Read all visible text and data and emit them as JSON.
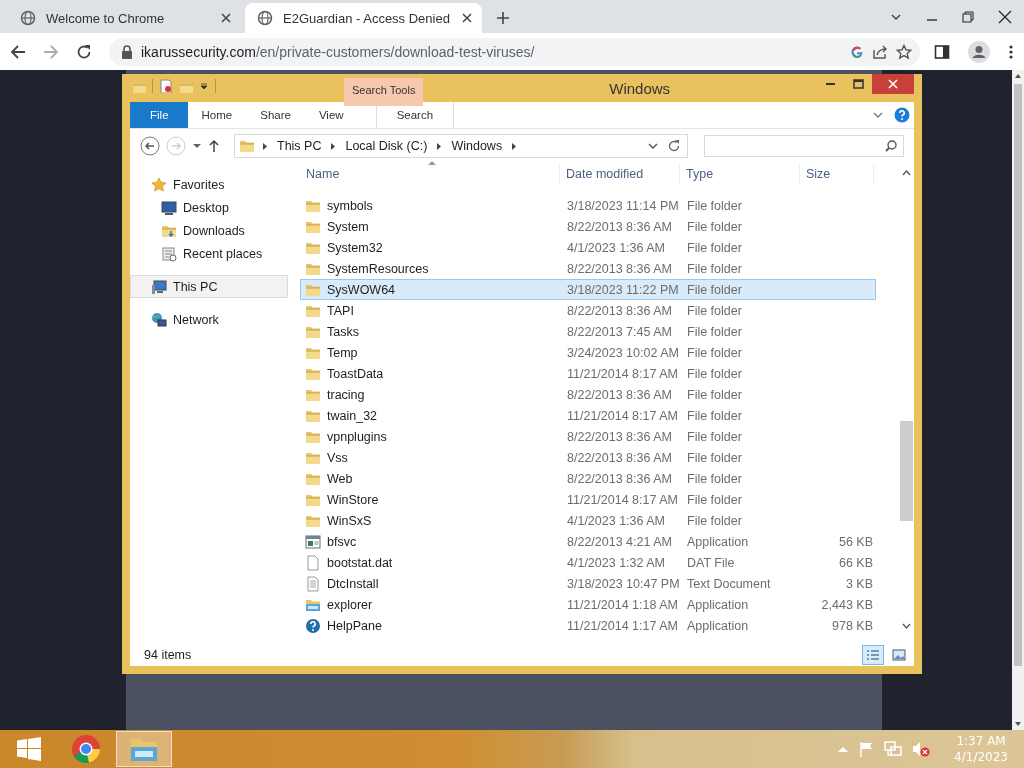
{
  "browser": {
    "tabs": [
      {
        "title": "Welcome to Chrome",
        "selected": false
      },
      {
        "title": "E2Guardian - Access Denied",
        "selected": true
      }
    ],
    "url_host": "ikarussecurity.com",
    "url_path": "/en/private-customers/download-test-viruses/"
  },
  "explorer": {
    "title": "Windows",
    "contextual_group": "Search Tools",
    "ribbon_tabs": [
      {
        "label": "File",
        "kind": "file"
      },
      {
        "label": "Home",
        "kind": "normal"
      },
      {
        "label": "Share",
        "kind": "normal"
      },
      {
        "label": "View",
        "kind": "normal"
      },
      {
        "label": "Search",
        "kind": "contextual"
      }
    ],
    "breadcrumb": [
      "This PC",
      "Local Disk (C:)",
      "Windows"
    ],
    "nav": [
      {
        "label": "Favorites",
        "kind": "star",
        "selected": false,
        "children": [
          {
            "label": "Desktop",
            "kind": "desktop",
            "selected": false
          },
          {
            "label": "Downloads",
            "kind": "downloads",
            "selected": false
          },
          {
            "label": "Recent places",
            "kind": "recent",
            "selected": false
          }
        ]
      },
      {
        "label": "This PC",
        "kind": "pc",
        "selected": true
      },
      {
        "label": "Network",
        "kind": "network",
        "selected": false
      }
    ],
    "columns": [
      "Name",
      "Date modified",
      "Type",
      "Size"
    ],
    "rows": [
      {
        "name": "symbols",
        "date": "3/18/2023 11:14 PM",
        "type": "File folder",
        "size": "",
        "kind": "folder",
        "selected": false
      },
      {
        "name": "System",
        "date": "8/22/2013 8:36 AM",
        "type": "File folder",
        "size": "",
        "kind": "folder",
        "selected": false
      },
      {
        "name": "System32",
        "date": "4/1/2023 1:36 AM",
        "type": "File folder",
        "size": "",
        "kind": "folder",
        "selected": false
      },
      {
        "name": "SystemResources",
        "date": "8/22/2013 8:36 AM",
        "type": "File folder",
        "size": "",
        "kind": "folder",
        "selected": false
      },
      {
        "name": "SysWOW64",
        "date": "3/18/2023 11:22 PM",
        "type": "File folder",
        "size": "",
        "kind": "folder",
        "selected": true
      },
      {
        "name": "TAPI",
        "date": "8/22/2013 8:36 AM",
        "type": "File folder",
        "size": "",
        "kind": "folder",
        "selected": false
      },
      {
        "name": "Tasks",
        "date": "8/22/2013 7:45 AM",
        "type": "File folder",
        "size": "",
        "kind": "folder",
        "selected": false
      },
      {
        "name": "Temp",
        "date": "3/24/2023 10:02 AM",
        "type": "File folder",
        "size": "",
        "kind": "folder",
        "selected": false
      },
      {
        "name": "ToastData",
        "date": "11/21/2014 8:17 AM",
        "type": "File folder",
        "size": "",
        "kind": "folder",
        "selected": false
      },
      {
        "name": "tracing",
        "date": "8/22/2013 8:36 AM",
        "type": "File folder",
        "size": "",
        "kind": "folder",
        "selected": false
      },
      {
        "name": "twain_32",
        "date": "11/21/2014 8:17 AM",
        "type": "File folder",
        "size": "",
        "kind": "folder",
        "selected": false
      },
      {
        "name": "vpnplugins",
        "date": "8/22/2013 8:36 AM",
        "type": "File folder",
        "size": "",
        "kind": "folder",
        "selected": false
      },
      {
        "name": "Vss",
        "date": "8/22/2013 8:36 AM",
        "type": "File folder",
        "size": "",
        "kind": "folder",
        "selected": false
      },
      {
        "name": "Web",
        "date": "8/22/2013 8:36 AM",
        "type": "File folder",
        "size": "",
        "kind": "folder",
        "selected": false
      },
      {
        "name": "WinStore",
        "date": "11/21/2014 8:17 AM",
        "type": "File folder",
        "size": "",
        "kind": "folder",
        "selected": false
      },
      {
        "name": "WinSxS",
        "date": "4/1/2023 1:36 AM",
        "type": "File folder",
        "size": "",
        "kind": "folder",
        "selected": false
      },
      {
        "name": "bfsvc",
        "date": "8/22/2013 4:21 AM",
        "type": "Application",
        "size": "56 KB",
        "kind": "app",
        "selected": false
      },
      {
        "name": "bootstat.dat",
        "date": "4/1/2023 1:32 AM",
        "type": "DAT File",
        "size": "66 KB",
        "kind": "file",
        "selected": false
      },
      {
        "name": "DtcInstall",
        "date": "3/18/2023 10:47 PM",
        "type": "Text Document",
        "size": "3 KB",
        "kind": "text",
        "selected": false
      },
      {
        "name": "explorer",
        "date": "11/21/2014 1:18 AM",
        "type": "Application",
        "size": "2,443 KB",
        "kind": "explorer",
        "selected": false
      },
      {
        "name": "HelpPane",
        "date": "11/21/2014 1:17 AM",
        "type": "Application",
        "size": "978 KB",
        "kind": "help",
        "selected": false
      }
    ],
    "status": "94 items"
  },
  "taskbar": {
    "apps": [
      {
        "kind": "chrome",
        "selected": false
      },
      {
        "kind": "explorer",
        "selected": true
      }
    ],
    "time": "1:37 AM",
    "date": "4/1/2023"
  }
}
